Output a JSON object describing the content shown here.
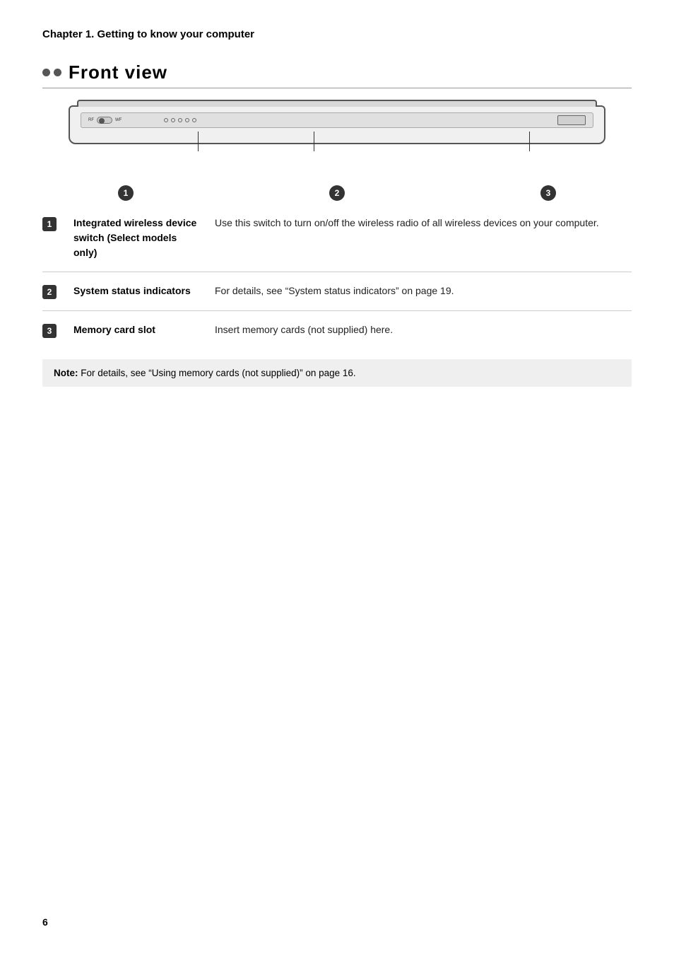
{
  "chapter": {
    "title": "Chapter 1. Getting to know your computer"
  },
  "section": {
    "title": "Front  view",
    "dots": [
      "dot1",
      "dot2"
    ]
  },
  "callouts": [
    "1",
    "2",
    "3"
  ],
  "items": [
    {
      "number": "1",
      "label": "Integrated wireless device switch (Select models only)",
      "description": "Use this switch to turn on/off the wireless radio of all wireless devices on your computer."
    },
    {
      "number": "2",
      "label": "System status indicators",
      "description": "For details, see “System status indicators” on page 19."
    },
    {
      "number": "3",
      "label": "Memory card slot",
      "description": "Insert memory cards (not supplied) here."
    }
  ],
  "note": {
    "bold_part": "Note:",
    "text": " For details, see “Using memory cards (not supplied)” on page 16."
  },
  "page_number": "6"
}
